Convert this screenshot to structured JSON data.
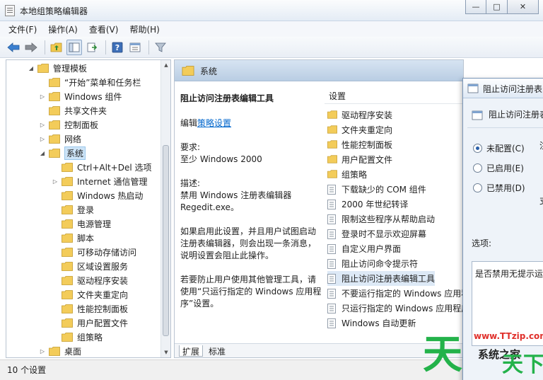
{
  "window": {
    "title": "本地组策略编辑器",
    "buttons": {
      "minimize": "—",
      "maximize": "□",
      "close": "✕"
    }
  },
  "menu": [
    "文件(F)",
    "操作(A)",
    "查看(V)",
    "帮助(H)"
  ],
  "tree": {
    "items": [
      {
        "label": "管理模板",
        "expanded": true
      },
      {
        "label": "“开始”菜单和任务栏"
      },
      {
        "label": "Windows 组件"
      },
      {
        "label": "共享文件夹"
      },
      {
        "label": "控制面板"
      },
      {
        "label": "网络"
      },
      {
        "label": "系统",
        "selected": true
      },
      {
        "label": "Ctrl+Alt+Del 选项"
      },
      {
        "label": "Internet 通信管理"
      },
      {
        "label": "Windows 热启动"
      },
      {
        "label": "登录"
      },
      {
        "label": "电源管理"
      },
      {
        "label": "脚本"
      },
      {
        "label": "可移动存储访问"
      },
      {
        "label": "区域设置服务"
      },
      {
        "label": "驱动程序安装"
      },
      {
        "label": "文件夹重定向"
      },
      {
        "label": "性能控制面板"
      },
      {
        "label": "用户配置文件"
      },
      {
        "label": "组策略"
      },
      {
        "label": "桌面"
      }
    ]
  },
  "content": {
    "header": "系统",
    "description": {
      "policy_title": "阻止访问注册表编辑工具",
      "edit_prefix": "编辑",
      "edit_link": "策略设置",
      "requirement_label": "要求:",
      "requirement_value": "至少 Windows 2000",
      "desc_label": "描述:",
      "desc_value": "禁用 Windows 注册表编辑器 Regedit.exe。",
      "desc_p2": "如果启用此设置，并且用户试图启动注册表编辑器，则会出现一条消息，说明设置会阻止此操作。",
      "desc_p3": "若要防止用户使用其他管理工具，请使用“只运行指定的 Windows 应用程序”设置。"
    },
    "settings_header": "设置",
    "settings": [
      {
        "label": "驱动程序安装",
        "type": "folder"
      },
      {
        "label": "文件夹重定向",
        "type": "folder"
      },
      {
        "label": "性能控制面板",
        "type": "folder"
      },
      {
        "label": "用户配置文件",
        "type": "folder"
      },
      {
        "label": "组策略",
        "type": "folder"
      },
      {
        "label": "下载缺少的 COM 组件",
        "type": "policy"
      },
      {
        "label": "2000 年世纪转译",
        "type": "policy"
      },
      {
        "label": "限制这些程序从帮助启动",
        "type": "policy"
      },
      {
        "label": "登录时不显示欢迎屏幕",
        "type": "policy"
      },
      {
        "label": "自定义用户界面",
        "type": "policy"
      },
      {
        "label": "阻止访问命令提示符",
        "type": "policy"
      },
      {
        "label": "阻止访问注册表编辑工具",
        "type": "policy",
        "selected": true
      },
      {
        "label": "不要运行指定的 Windows 应用程",
        "type": "policy"
      },
      {
        "label": "只运行指定的 Windows 应用程序",
        "type": "policy"
      },
      {
        "label": "Windows 自动更新",
        "type": "policy"
      }
    ],
    "tabs": {
      "extended": "扩展",
      "standard": "标准"
    }
  },
  "status": "10 个设置",
  "dialog": {
    "title": "阻止访问注册表",
    "subtitle": "阻止访问注册表编",
    "options": [
      {
        "label": "未配置(C)",
        "checked": true
      },
      {
        "label": "已启用(E)",
        "checked": false
      },
      {
        "label": "已禁用(D)",
        "checked": false
      }
    ],
    "cut_1": "注",
    "cut_2": "支",
    "options_label": "选项:",
    "options_text": "是否禁用无提示运行"
  },
  "watermark": {
    "url": "www.TTzip.com",
    "big": "天",
    "small": "系统之家",
    "big2": "天下载"
  }
}
